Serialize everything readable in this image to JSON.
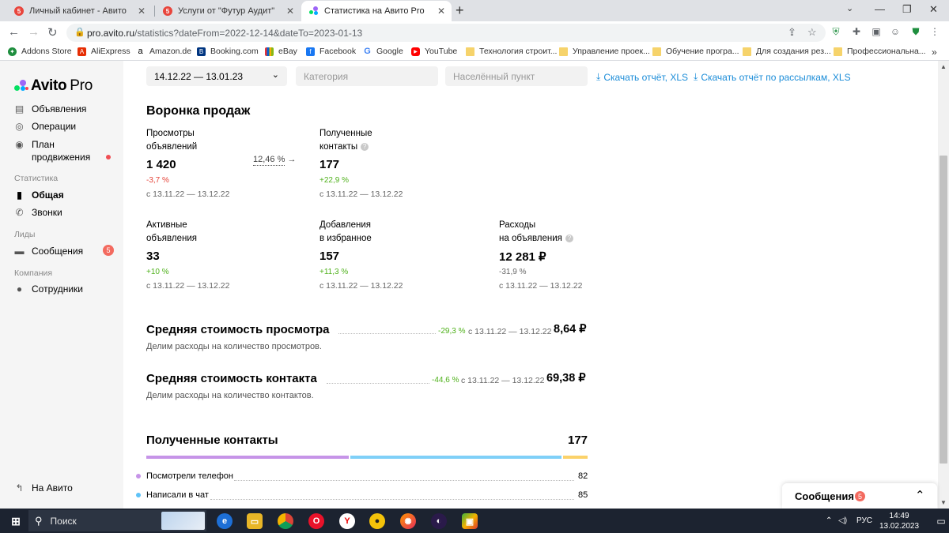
{
  "browser": {
    "tabs": [
      {
        "title": "Личный кабинет - Авито",
        "badge": "5"
      },
      {
        "title": "Услуги от \"Футур Аудит\"",
        "badge": "5"
      },
      {
        "title": "Статистика на Авито Pro",
        "active": true
      }
    ],
    "url_host": "pro.avito.ru",
    "url_path": "/statistics?dateFrom=2022-12-14&dateTo=2023-01-13",
    "bookmarks": [
      "Addons Store",
      "AliExpress",
      "Amazon.de",
      "Booking.com",
      "eBay",
      "Facebook",
      "Google",
      "YouTube",
      "Технология строит...",
      "Управление проек...",
      "Обучение програ...",
      "Для создания рез...",
      "Профессиональна..."
    ],
    "bookmarks_more": "»"
  },
  "sidebar": {
    "logo_text": "Avito",
    "logo_pro": "Pro",
    "items": {
      "ads": "Объявления",
      "operations": "Операции",
      "promo_line1": "План",
      "promo_line2": "продвижения",
      "general": "Общая",
      "calls": "Звонки",
      "messages": "Сообщения",
      "messages_badge": "5",
      "employees": "Сотрудники",
      "to_avito": "На Авито"
    },
    "sections": {
      "stats": "Статистика",
      "leads": "Лиды",
      "company": "Компания"
    }
  },
  "filters": {
    "date_range": "14.12.22 — 13.01.23",
    "category_placeholder": "Категория",
    "city_placeholder": "Населённый пункт",
    "download_report": "Скачать отчёт, XLS",
    "download_mailing": "Скачать отчёт по рассылкам, XLS"
  },
  "funnel": {
    "title": "Воронка продаж",
    "conversion": "12,46 %",
    "cards": {
      "views": {
        "label1": "Просмотры",
        "label2": "объявлений",
        "value": "1 420",
        "change": "-3,7 %",
        "period": "с 13.11.22 — 13.12.22"
      },
      "contacts": {
        "label1": "Полученные",
        "label2": "контакты",
        "value": "177",
        "change": "+22,9 %",
        "period": "с 13.11.22 — 13.12.22"
      },
      "active": {
        "label1": "Активные",
        "label2": "объявления",
        "value": "33",
        "change": "+10 %",
        "period": "с 13.11.22 — 13.12.22"
      },
      "favorites": {
        "label1": "Добавления",
        "label2": "в избранное",
        "value": "157",
        "change": "+11,3 %",
        "period": "с 13.11.22 — 13.12.22"
      },
      "expenses": {
        "label1": "Расходы",
        "label2": "на объявления",
        "value": "12 281 ₽",
        "change": "-31,9 %",
        "period": "с 13.11.22 — 13.12.22"
      }
    }
  },
  "avg_view": {
    "title": "Средняя стоимость просмотра",
    "change": "-29,3 %",
    "period": "с 13.11.22 — 13.12.22",
    "value": "8,64 ₽",
    "subtitle": "Делим расходы на количество просмотров."
  },
  "avg_contact": {
    "title": "Средняя стоимость контакта",
    "change": "-44,6 %",
    "period": "с 13.11.22 — 13.12.22",
    "value": "69,38 ₽",
    "subtitle": "Делим расходы на количество контактов."
  },
  "contacts_block": {
    "title": "Полученные контакты",
    "total": "177",
    "rows": [
      {
        "label": "Посмотрели телефон",
        "value": "82",
        "color": "#c694e8"
      },
      {
        "label": "Написали в чат",
        "value": "85",
        "color": "#5ec2f7"
      }
    ],
    "bar_colors": [
      "#c694e8",
      "#7fd0f8",
      "#fbd26a"
    ]
  },
  "messages_panel": {
    "title": "Сообщения",
    "badge": "5"
  },
  "taskbar": {
    "search": "Поиск",
    "lang": "РУС",
    "time": "14:49",
    "date": "13.02.2023"
  },
  "colors": {
    "accent_link": "#1a8cd8",
    "negative": "#e5463b",
    "positive": "#4fb11b"
  }
}
